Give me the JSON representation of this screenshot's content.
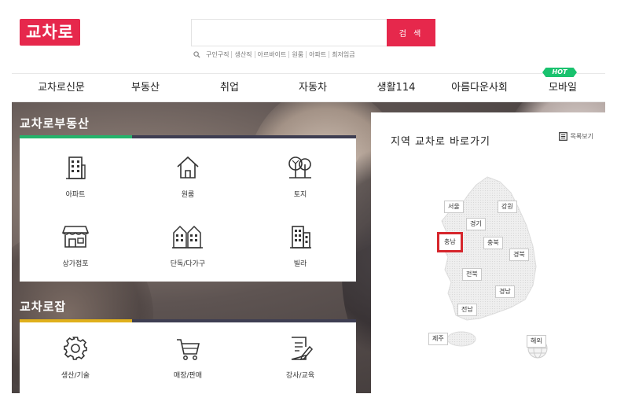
{
  "header": {
    "logo_text": "교차로",
    "search": {
      "placeholder": "",
      "button_label": "검 색"
    },
    "keywords": [
      "구인구직",
      "생산직",
      "아르바이트",
      "원룸",
      "아파트",
      "최저임금"
    ]
  },
  "nav": {
    "items": [
      {
        "label": "교차로신문"
      },
      {
        "label": "부동산"
      },
      {
        "label": "취업"
      },
      {
        "label": "자동차"
      },
      {
        "label": "생활114"
      },
      {
        "label": "아름다운사회"
      },
      {
        "label": "모바일"
      }
    ],
    "hot_badge": "HOT"
  },
  "real_estate": {
    "title": "교차로부동산",
    "items": [
      {
        "label": "아파트",
        "icon": "apartment-icon"
      },
      {
        "label": "원룸",
        "icon": "house-icon"
      },
      {
        "label": "토지",
        "icon": "tree-icon"
      },
      {
        "label": "상가점포",
        "icon": "store-icon"
      },
      {
        "label": "단독/다가구",
        "icon": "townhouse-icon"
      },
      {
        "label": "빌라",
        "icon": "villa-icon"
      }
    ],
    "bar_colors": [
      "#25b36b",
      "#3e3e52",
      "#3e3e52"
    ]
  },
  "jobs": {
    "title": "교차로잡",
    "items": [
      {
        "label": "생산/기술",
        "icon": "gear-icon"
      },
      {
        "label": "매장/판매",
        "icon": "cart-icon"
      },
      {
        "label": "강사/교육",
        "icon": "document-pen-icon"
      }
    ],
    "bar_colors": [
      "#e0b01b",
      "#3e3e52",
      "#3e3e52"
    ]
  },
  "region": {
    "title": "지역 교차로 바로가기",
    "list_view_label": "목록보기",
    "regions": [
      {
        "label": "서울"
      },
      {
        "label": "강원"
      },
      {
        "label": "경기"
      },
      {
        "label": "충북"
      },
      {
        "label": "충남",
        "selected": true
      },
      {
        "label": "경북"
      },
      {
        "label": "전북"
      },
      {
        "label": "경남"
      },
      {
        "label": "전남"
      },
      {
        "label": "제주"
      },
      {
        "label": "해외"
      }
    ]
  },
  "colors": {
    "brand": "#e6284c",
    "hot": "#19c26e",
    "selected_border": "#d6262c"
  }
}
